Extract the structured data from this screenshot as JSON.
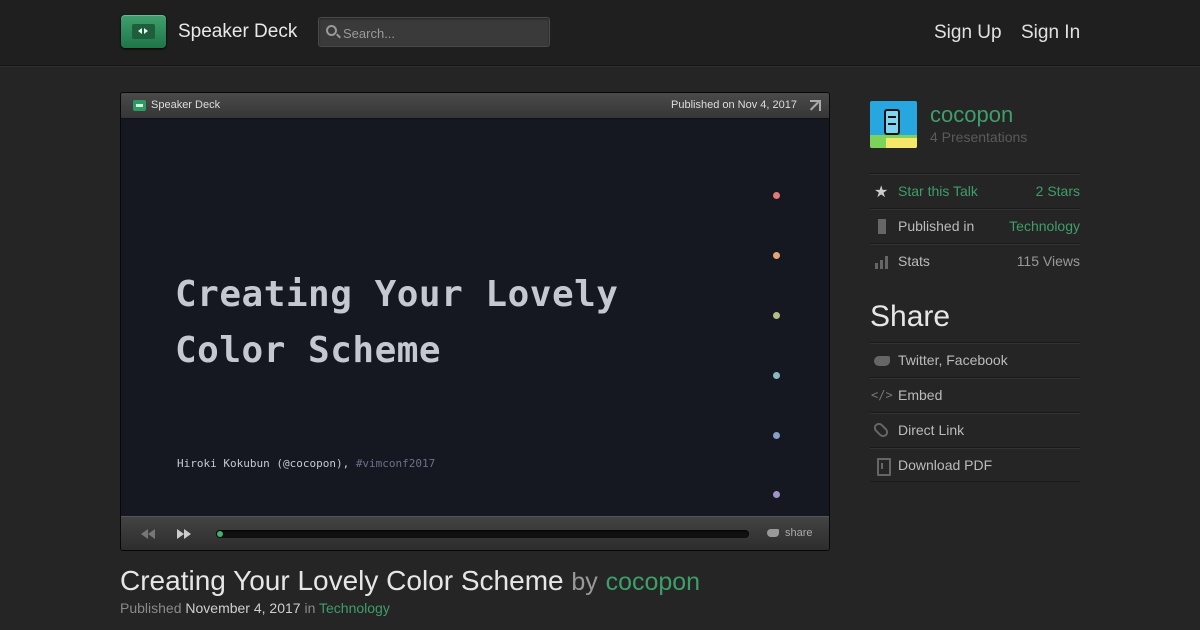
{
  "header": {
    "logo_text": "Speaker Deck",
    "search_placeholder": "Search...",
    "nav": {
      "sign_up": "Sign Up",
      "sign_in": "Sign In"
    }
  },
  "player": {
    "brand": "Speaker Deck",
    "published": "Published on Nov 4, 2017",
    "slide": {
      "title_line1": "Creating Your Lovely",
      "title_line2": "Color Scheme",
      "author": "Hiroki Kokubun (@cocopon), ",
      "hashtag": "#vimconf2017",
      "dot_colors": [
        "#e27878",
        "#e2a478",
        "#b4be82",
        "#89b8c2",
        "#84a0c6",
        "#a093c7"
      ]
    },
    "progress_fraction": 0.01,
    "share_label": "share"
  },
  "talk": {
    "title": "Creating Your Lovely Color Scheme",
    "by": "by",
    "author": "cocopon",
    "published_label": "Published",
    "date": "November 4, 2017",
    "in_label": "in",
    "category": "Technology"
  },
  "sidebar": {
    "user": {
      "name": "cocopon",
      "presentations": "4 Presentations"
    },
    "star": {
      "label": "Star this Talk",
      "value": "2 Stars"
    },
    "published_in": {
      "label": "Published in",
      "value": "Technology"
    },
    "stats": {
      "label": "Stats",
      "value": "115 Views"
    },
    "share_heading": "Share",
    "share_items": {
      "social": "Twitter, Facebook",
      "embed": "Embed",
      "direct": "Direct Link",
      "pdf": "Download PDF"
    }
  },
  "colors": {
    "accent": "#3e9e6a",
    "background": "#252525"
  }
}
